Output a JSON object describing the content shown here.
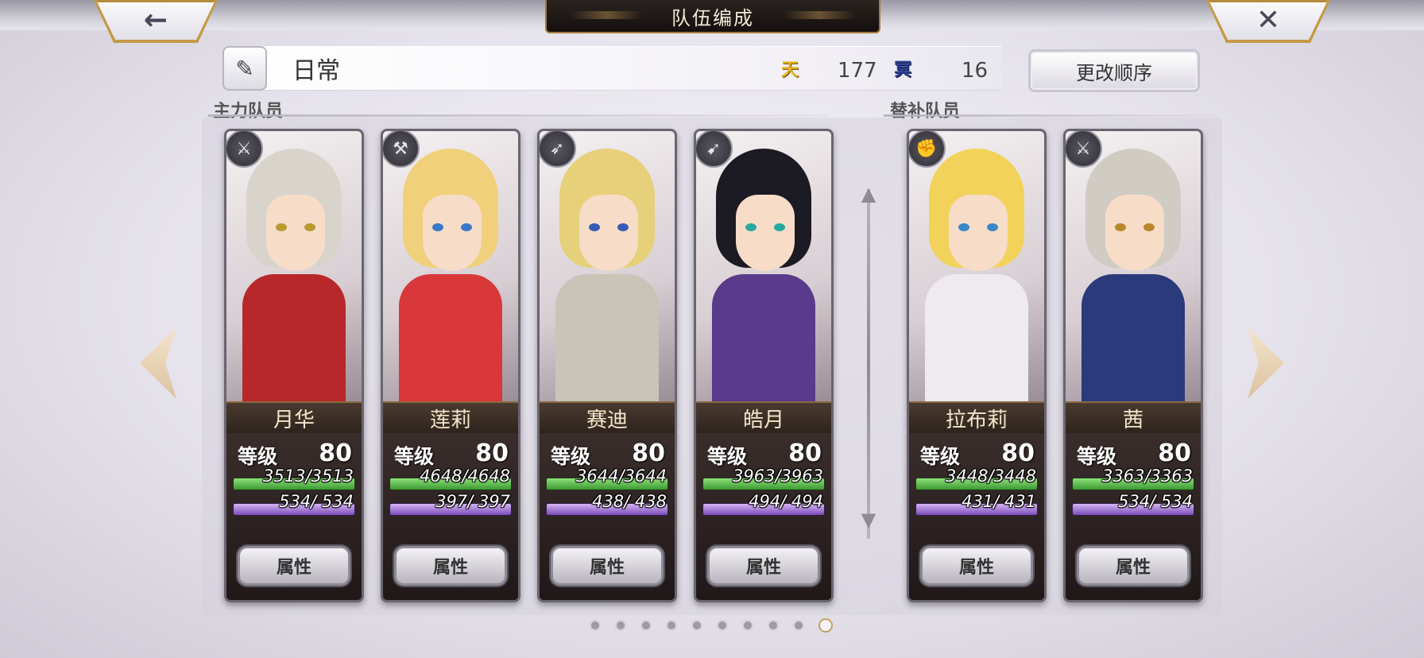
{
  "header": {
    "title": "队伍编成",
    "back_icon": "←",
    "close_icon": "✕"
  },
  "team": {
    "name": "日常",
    "edit_icon": "✎",
    "tian_icon": "天",
    "tian_value": "177",
    "ming_icon": "冥",
    "ming_value": "16",
    "order_button": "更改顺序"
  },
  "sections": {
    "main": "主力队员",
    "sub": "替补队员"
  },
  "characters": [
    {
      "name": "月华",
      "level_label": "等级",
      "level": "80",
      "hp": "3513/3513",
      "mp": "534/ 534",
      "attr": "属性",
      "class_icon": "sword-icon",
      "hair": "#d8d4cc",
      "outfit": "#b8282a",
      "eye": "#b89a30"
    },
    {
      "name": "莲莉",
      "level_label": "等级",
      "level": "80",
      "hp": "4648/4648",
      "mp": "397/ 397",
      "attr": "属性",
      "class_icon": "axe-icon",
      "hair": "#f0d07a",
      "outfit": "#d8383a",
      "eye": "#3a78c8"
    },
    {
      "name": "赛迪",
      "level_label": "等级",
      "level": "80",
      "hp": "3644/3644",
      "mp": "438/ 438",
      "attr": "属性",
      "class_icon": "spear-icon",
      "hair": "#e6d07a",
      "outfit": "#c8c4b8",
      "eye": "#3a5ab8"
    },
    {
      "name": "皓月",
      "level_label": "等级",
      "level": "80",
      "hp": "3963/3963",
      "mp": "494/ 494",
      "attr": "属性",
      "class_icon": "bow-icon",
      "hair": "#1c1a22",
      "outfit": "#5a3a8a",
      "eye": "#2aa8a0"
    },
    {
      "name": "拉布莉",
      "level_label": "等级",
      "level": "80",
      "hp": "3448/3448",
      "mp": "431/ 431",
      "attr": "属性",
      "class_icon": "fist-icon",
      "hair": "#f2d25a",
      "outfit": "#eeeaf0",
      "eye": "#3a88c8"
    },
    {
      "name": "茜",
      "level_label": "等级",
      "level": "80",
      "hp": "3363/3363",
      "mp": "534/ 534",
      "attr": "属性",
      "class_icon": "sword-icon",
      "hair": "#d0ccc4",
      "outfit": "#2a3a7a",
      "eye": "#b8882a"
    }
  ],
  "pager": {
    "count": 10,
    "active_index": 9
  }
}
